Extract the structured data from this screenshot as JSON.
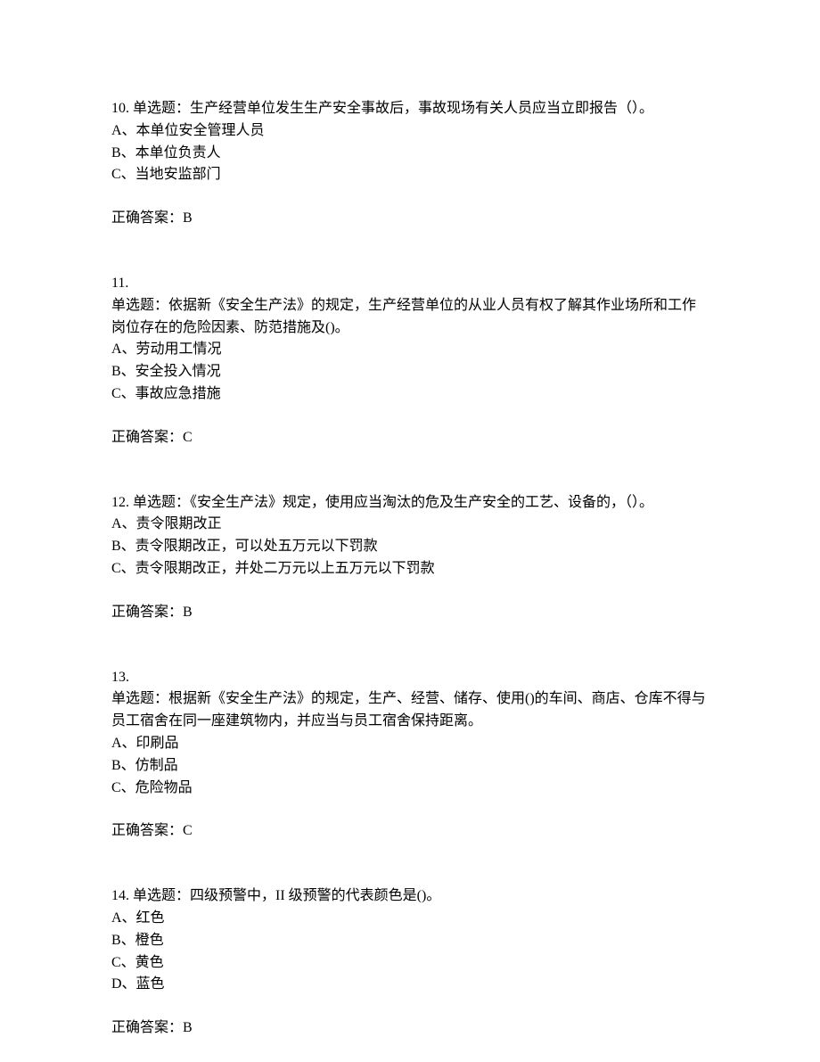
{
  "questions": [
    {
      "num": "10.",
      "type_label": " 单选题：",
      "stem_inline": "生产经营单位发生生产安全事故后，事故现场有关人员应当立即报告（）。",
      "stem_lines": [],
      "options": [
        "A、本单位安全管理人员",
        "B、本单位负责人",
        "C、当地安监部门"
      ],
      "answer_label": "正确答案：",
      "answer_value": "B"
    },
    {
      "num": "11.",
      "type_label": "单选题：",
      "stem_inline": "",
      "stem_lines": [
        "依据新《安全生产法》的规定，生产经营单位的从业人员有权了解其作业场所和工作岗位存在的危险因素、防范措施及()。"
      ],
      "options": [
        "A、劳动用工情况",
        "B、安全投入情况",
        "C、事故应急措施"
      ],
      "answer_label": "正确答案：",
      "answer_value": "C"
    },
    {
      "num": "12.",
      "type_label": " 单选题：",
      "stem_inline": "《安全生产法》规定，使用应当淘汰的危及生产安全的工艺、设备的，（）。",
      "stem_lines": [],
      "options": [
        "A、责令限期改正",
        "B、责令限期改正，可以处五万元以下罚款",
        "C、责令限期改正，并处二万元以上五万元以下罚款"
      ],
      "answer_label": "正确答案：",
      "answer_value": "B"
    },
    {
      "num": "13.",
      "type_label": "单选题：",
      "stem_inline": "",
      "stem_lines": [
        "根据新《安全生产法》的规定，生产、经营、储存、使用()的车间、商店、仓库不得与员工宿舍在同一座建筑物内，并应当与员工宿舍保持距离。"
      ],
      "options": [
        "A、印刷品",
        "B、仿制品",
        "C、危险物品"
      ],
      "answer_label": "正确答案：",
      "answer_value": "C"
    },
    {
      "num": "14.",
      "type_label": " 单选题：",
      "stem_inline": "四级预警中，II 级预警的代表颜色是()。",
      "stem_lines": [],
      "options": [
        "A、红色",
        "B、橙色",
        "C、黄色",
        "D、蓝色"
      ],
      "answer_label": "正确答案：",
      "answer_value": "B"
    }
  ]
}
